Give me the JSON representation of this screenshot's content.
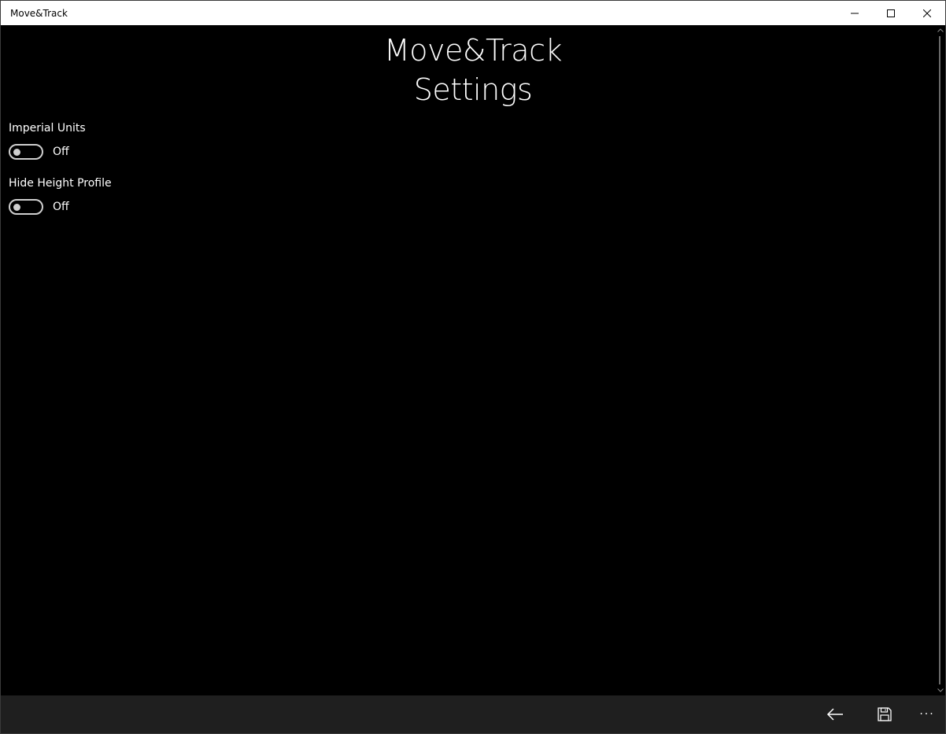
{
  "window": {
    "title": "Move&Track"
  },
  "page": {
    "title": "Move&Track",
    "subtitle": "Settings"
  },
  "settings": [
    {
      "label": "Imperial Units",
      "state": "Off",
      "on": false
    },
    {
      "label": "Hide Height Profile",
      "state": "Off",
      "on": false
    }
  ],
  "commandbar": {
    "icons": [
      "back-arrow-icon",
      "save-icon"
    ],
    "more": "···"
  },
  "colors": {
    "background": "#000000",
    "commandbar": "#1f1f1f",
    "titlebar": "#ffffff",
    "text": "#ffffff"
  }
}
